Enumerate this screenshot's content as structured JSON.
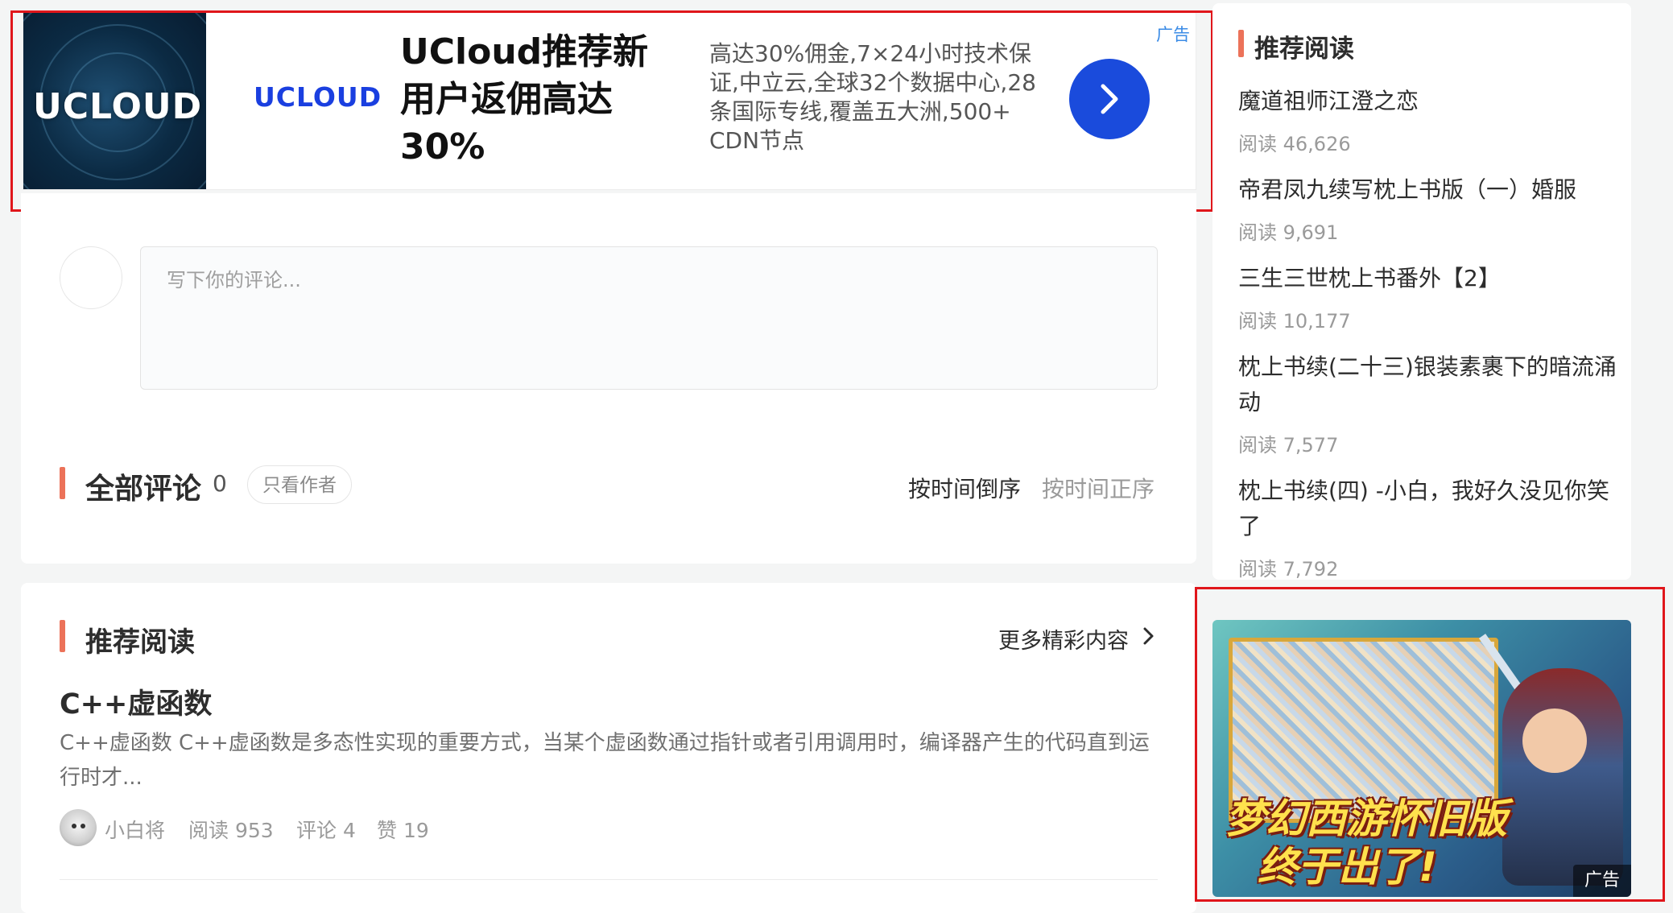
{
  "top_ad": {
    "thumb_logo": "UCLOUD",
    "brand": "UCLOUD",
    "title": "UCloud推荐新用户返佣高达30%",
    "description": "高达30%佣金,7×24小时技术保证,中立云,全球32个数据中心,28条国际专线,覆盖五大洲,500+ CDN节点",
    "tag": "广告",
    "go_icon": "chevron-right-icon",
    "close_icon": "close-icon",
    "colors": {
      "button": "#1a4bdc",
      "brand": "#1a3fe0",
      "highlight_frame": "#e0161b"
    }
  },
  "comments": {
    "input_placeholder": "写下你的评论...",
    "section_title": "全部评论",
    "count": "0",
    "author_only": "只看作者",
    "sort_desc": "按时间倒序",
    "sort_asc": "按时间正序"
  },
  "recommend_section": {
    "title": "推荐阅读",
    "more_label": "更多精彩内容",
    "articles": [
      {
        "title": "C++虚函数",
        "excerpt": "C++虚函数 C++虚函数是多态性实现的重要方式，当某个虚函数通过指针或者引用调用时，编译器产生的代码直到运行时才...",
        "author": "小白将",
        "reads": "阅读 953",
        "comments": "评论 4",
        "likes": "赞 19"
      }
    ]
  },
  "sidebar": {
    "title": "推荐阅读",
    "items": [
      {
        "title": "魔道祖师江澄之恋",
        "meta": "阅读 46,626"
      },
      {
        "title": "帝君凤九续写枕上书版（一）婚服",
        "meta": "阅读 9,691"
      },
      {
        "title": "三生三世枕上书番外【2】",
        "meta": "阅读 10,177"
      },
      {
        "title": "枕上书续(二十三)银装素裹下的暗流涌动",
        "meta": "阅读 7,577"
      },
      {
        "title": "枕上书续(四) -小白，我好久没见你笑了",
        "meta": "阅读 7,792"
      }
    ],
    "ad": {
      "slogan_line1": "梦幻西游怀旧版",
      "slogan_line2": "终于出了!",
      "tag": "广告"
    }
  },
  "colors": {
    "accent_bar": "#ec7259",
    "page_bg": "#f4f5f5"
  }
}
